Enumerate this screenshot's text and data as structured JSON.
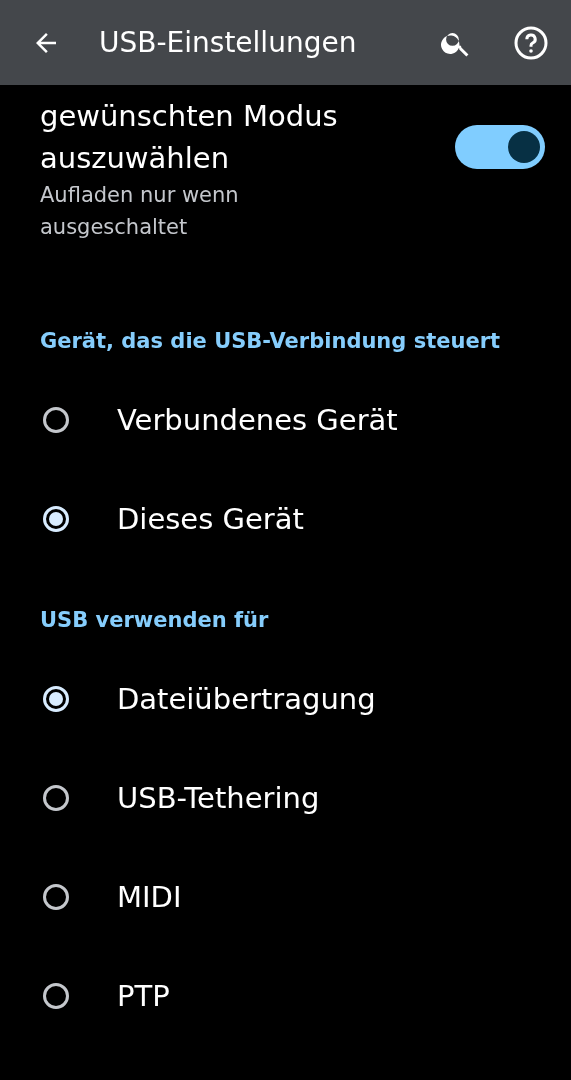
{
  "app_bar": {
    "title": "USB-Einstellungen"
  },
  "switch_row": {
    "title_lines": [
      "gewünschten Modus",
      "auszuwählen"
    ],
    "summary": "Aufladen nur wenn ausgeschaltet",
    "on": true
  },
  "sections": [
    {
      "header": "Gerät, das die USB-Verbindung steuert",
      "options": [
        {
          "label": "Verbundenes Gerät",
          "selected": false
        },
        {
          "label": "Dieses Gerät",
          "selected": true
        }
      ]
    },
    {
      "header": "USB verwenden für",
      "options": [
        {
          "label": "Dateiübertragung",
          "selected": true
        },
        {
          "label": "USB-Tethering",
          "selected": false
        },
        {
          "label": "MIDI",
          "selected": false
        },
        {
          "label": "PTP",
          "selected": false
        }
      ]
    }
  ]
}
